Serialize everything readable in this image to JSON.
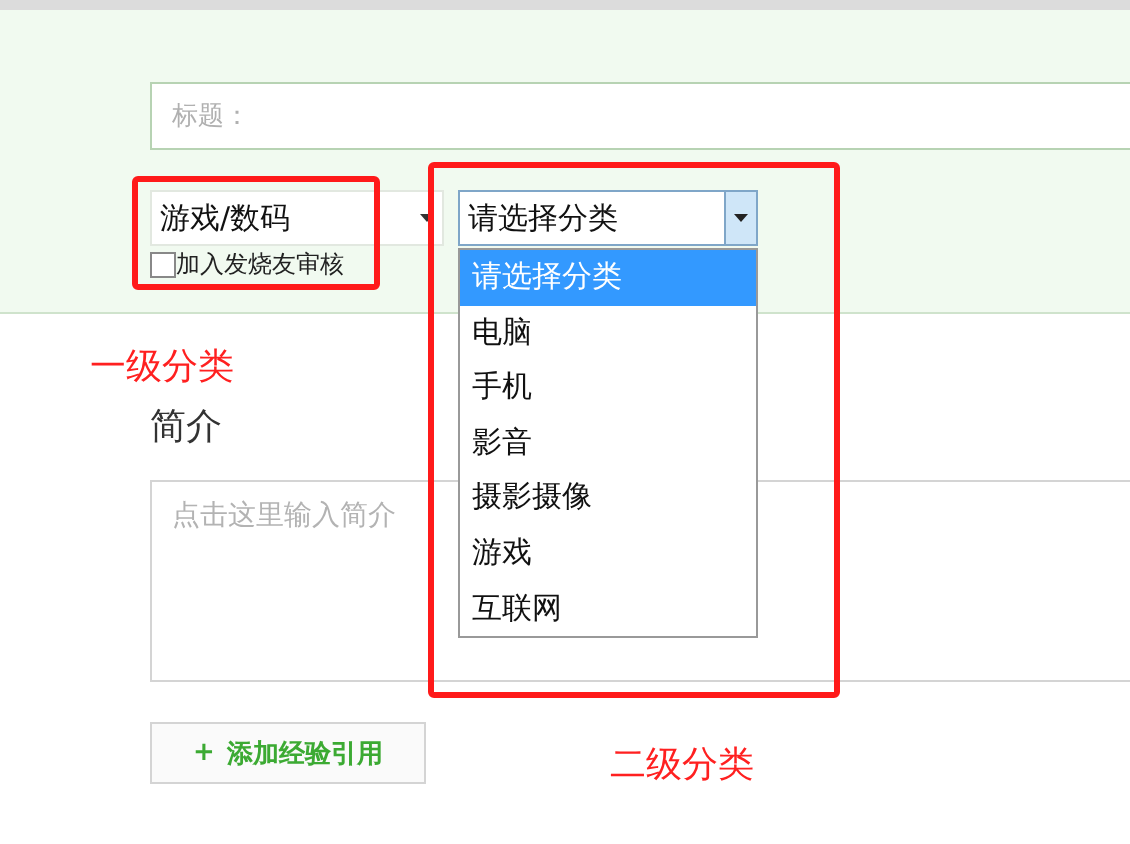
{
  "title_field": {
    "placeholder": "标题："
  },
  "category_select": {
    "value": "游戏/数码"
  },
  "subcategory_select": {
    "value": "请选择分类",
    "expanded": true,
    "options": [
      {
        "label": "请选择分类",
        "selected": true
      },
      {
        "label": "电脑",
        "selected": false
      },
      {
        "label": "手机",
        "selected": false
      },
      {
        "label": "影音",
        "selected": false
      },
      {
        "label": "摄影摄像",
        "selected": false
      },
      {
        "label": "游戏",
        "selected": false
      },
      {
        "label": "互联网",
        "selected": false
      }
    ]
  },
  "review_checkbox": {
    "label": "加入发烧友审核",
    "checked": false
  },
  "summary": {
    "heading": "简介",
    "placeholder": "点击这里输入简介"
  },
  "add_reference_button": {
    "icon_text": "+",
    "label": "添加经验引用"
  },
  "annotations": [
    {
      "label": "一级分类"
    },
    {
      "label": "二级分类"
    }
  ]
}
